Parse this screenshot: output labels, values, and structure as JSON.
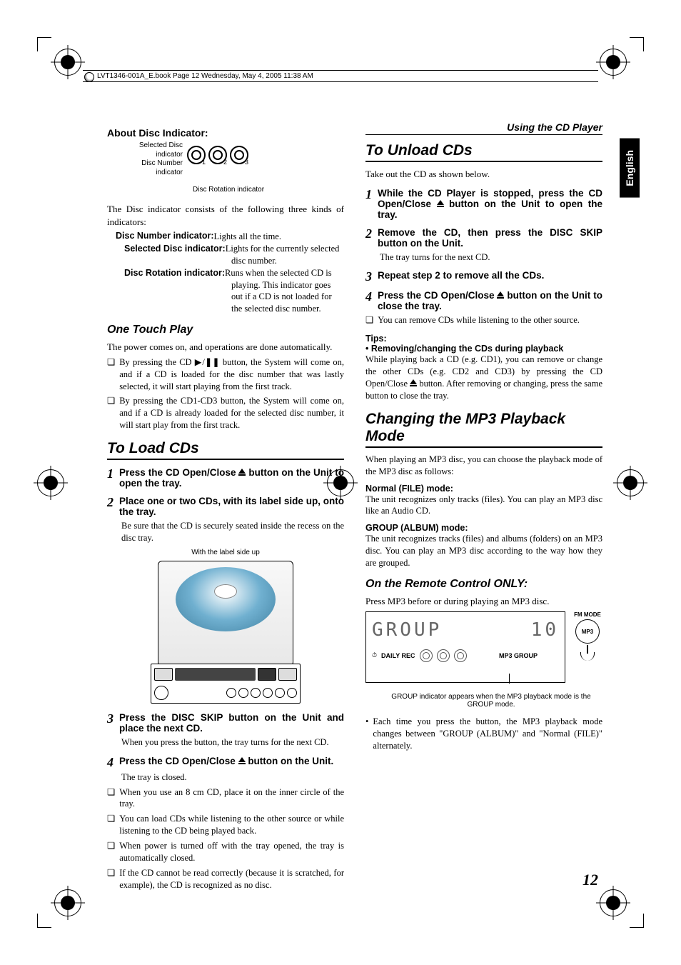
{
  "header_line": "LVT1346-001A_E.book  Page 12  Wednesday, May 4, 2005  11:38 AM",
  "running_head": "Using the CD Player",
  "lang_tab": "English",
  "page_number": "12",
  "left": {
    "about_title": "About Disc Indicator:",
    "ind_label1": "Selected Disc indicator",
    "ind_label2": "Disc Number indicator",
    "ind_caption": "Disc Rotation indicator",
    "disc_nums": [
      "1",
      "2",
      "3"
    ],
    "ind_intro": "The Disc indicator consists of the following three kinds of indicators:",
    "def1_term": "Disc Number indicator:",
    "def1_val": " Lights all the time.",
    "def2_term": "Selected Disc indicator:",
    "def2_val": "Lights for the currently selected disc number.",
    "def3_term": "Disc Rotation indicator:",
    "def3_val": "Runs when the selected CD is playing. This indicator goes out if a CD is not loaded for the selected disc number.",
    "one_touch_title": "One Touch Play",
    "one_touch_intro": "The power comes on, and operations are done automatically.",
    "ot_b1": "By pressing the CD ▶/❚❚ button, the System will come on, and if a CD is loaded for the disc number that was lastly selected, it will start playing from the first track.",
    "ot_b2": "By pressing the CD1-CD3 button, the System will come on, and if a CD is already loaded for the selected disc number, it will start play from the first track.",
    "load_title": "To Load CDs",
    "s1_pre": "Press the CD Open/Close ",
    "s1_post": " button on the Unit to open the tray.",
    "s2": "Place one or two CDs, with its label side up, onto the tray.",
    "s2_sub": "Be sure that the CD is securely seated inside the recess on the disc tray.",
    "illus_caption": "With the label side up",
    "s3": "Press the DISC SKIP button on the Unit and place the next CD.",
    "s3_sub": "When you press the button, the tray turns for the next CD.",
    "s4_pre": "Press the CD Open/Close ",
    "s4_post": " button on the Unit.",
    "s4_sub": "The tray is closed.",
    "n1": "When you use an 8 cm CD, place it on the inner circle of the tray.",
    "n2": "You can load CDs while listening to the other source or while listening to the CD being played back.",
    "n3": "When power is turned off with the tray opened, the tray is automatically closed.",
    "n4": "If the CD cannot be read correctly (because it is scratched, for example), the CD is recognized as no disc."
  },
  "right": {
    "unload_title": "To Unload CDs",
    "unload_intro": "Take out the CD as shown below.",
    "u1_pre": "While the CD Player is stopped, press the CD Open/Close ",
    "u1_post": " button on the Unit to open the tray.",
    "u2": "Remove the CD, then press the DISC SKIP button on the Unit.",
    "u2_sub": "The tray turns for the next CD.",
    "u3": "Repeat step 2 to remove all the CDs.",
    "u4_pre": "Press the CD Open/Close ",
    "u4_post": " button on the Unit to close the tray.",
    "u_note": "You can remove CDs while listening to the other source.",
    "tips": "Tips:",
    "tips_sub": "•   Removing/changing the CDs during playback",
    "tips_body_pre": "While playing back a CD (e.g. CD1), you can remove or change the other CDs (e.g. CD2 and CD3) by pressing the CD Open/Close ",
    "tips_body_post": " button. After removing or changing, press the same button to close the tray.",
    "mp3_title": "Changing the MP3 Playback Mode",
    "mp3_intro": "When playing an MP3 disc, you can choose the playback mode of the MP3 disc as follows:",
    "normal_label": "Normal (FILE) mode:",
    "normal_body": "The unit recognizes only tracks (files). You can play an MP3 disc like an Audio CD.",
    "group_label": "GROUP (ALBUM) mode:",
    "group_body": "The unit recognizes tracks (files) and albums (folders) on an MP3 disc. You can play an MP3 disc according to the way how they are grouped.",
    "remote_title": "On the Remote Control ONLY:",
    "remote_intro": "Press MP3 before or during playing an MP3 disc.",
    "fm_label": "FM MODE",
    "mp3_label": "MP3",
    "lcd_seg_left": "GROUP",
    "lcd_seg_right": "10",
    "lcd_daily": "DAILY REC",
    "lcd_clock": "⏱",
    "lcd_mp3grp": "MP3 GROUP",
    "lcd_caption": "GROUP indicator appears when the MP3 playback mode is the GROUP mode.",
    "footnote": "Each time you press the button, the MP3 playback mode changes between \"GROUP (ALBUM)\" and \"Normal (FILE)\" alternately."
  }
}
